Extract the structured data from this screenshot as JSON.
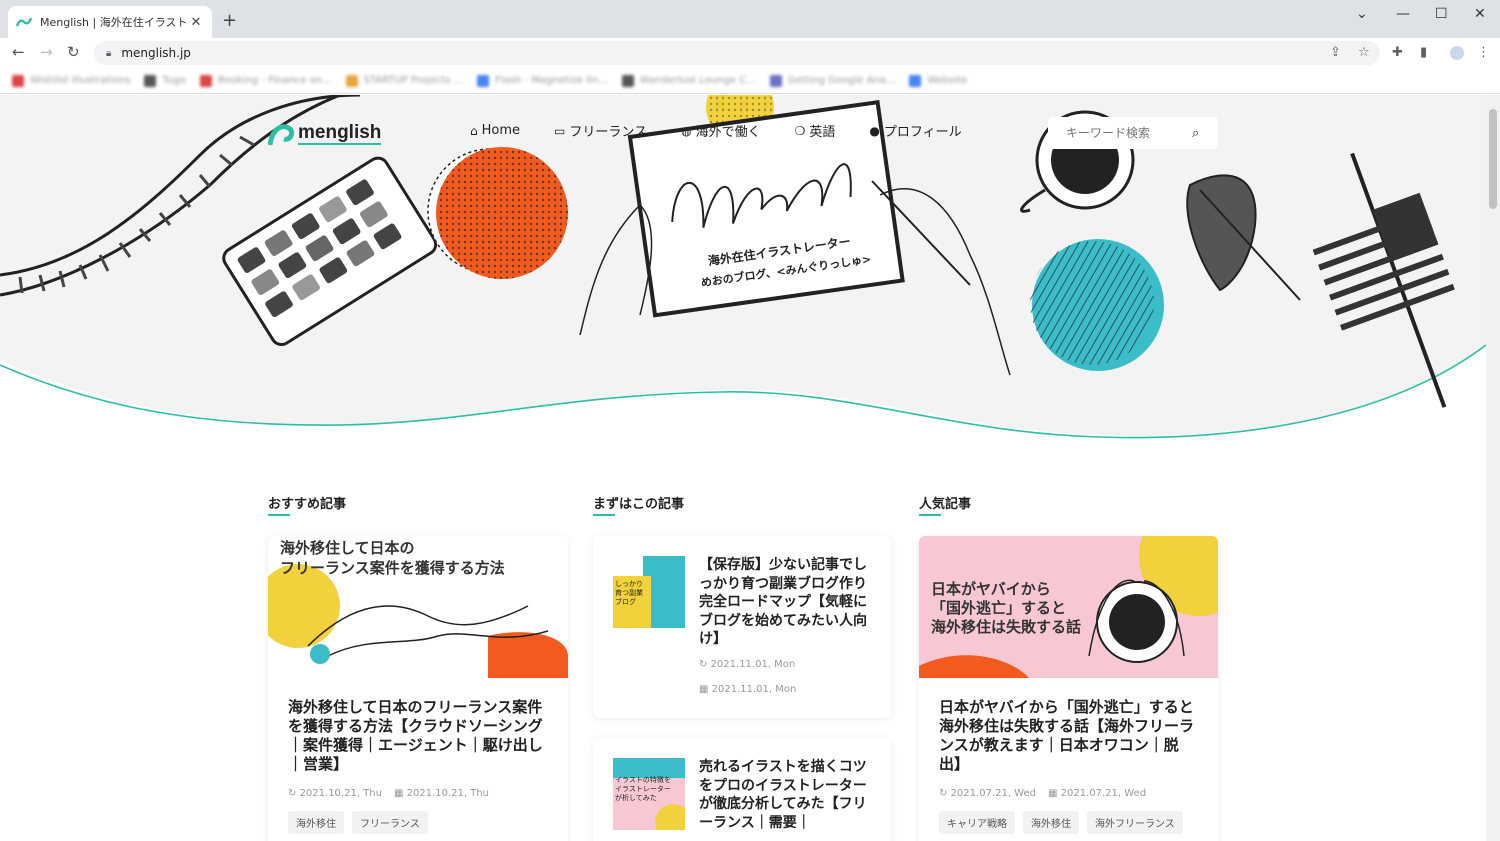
{
  "browser": {
    "tab_title": "Menglish | 海外在住イラストレータ...",
    "url": "menglish.jp",
    "bookmarks": [
      {
        "label": "Wishlist Illustrations",
        "color": "#d44"
      },
      {
        "label": "Tugo",
        "color": "#555"
      },
      {
        "label": "Booking - Finance on...",
        "color": "#d44"
      },
      {
        "label": "STARTUP Projects ...",
        "color": "#e8a33c"
      },
      {
        "label": "Flash - Magnetize lin...",
        "color": "#4285f4"
      },
      {
        "label": "Wanderlust Lounge C...",
        "color": "#555"
      },
      {
        "label": "Getting Google Ana...",
        "color": "#6b6fc4"
      },
      {
        "label": "Website",
        "color": "#4285f4"
      }
    ]
  },
  "site": {
    "logo_text": "menglish",
    "nav": [
      {
        "icon": "home-icon",
        "glyph": "⌂",
        "label": "Home"
      },
      {
        "icon": "laptop-icon",
        "glyph": "▭",
        "label": "フリーランス"
      },
      {
        "icon": "globe-icon",
        "glyph": "◍",
        "label": "海外で働く"
      },
      {
        "icon": "chat-icon",
        "glyph": "❍",
        "label": "英語"
      },
      {
        "icon": "user-icon",
        "glyph": "●",
        "label": "プロフィール"
      }
    ],
    "search_placeholder": "キーワード検索",
    "hero_text": {
      "line1": "海外在住イラストレーター",
      "line2": "めおのブログ、<みんぐりっしゅ>"
    }
  },
  "sections": {
    "recommended": {
      "title": "おすすめ記事",
      "thumb_text": [
        "海外移住して日本の",
        "フリーランス案件を獲得する方法"
      ],
      "article_title": "海外移住して日本のフリーランス案件を獲得する方法【クラウドソーシング｜案件獲得｜エージェント｜駆け出し｜営業】",
      "updated": "2021.10.21, Thu",
      "published": "2021.10.21, Thu",
      "tags": [
        "海外移住",
        "フリーランス"
      ]
    },
    "first": {
      "title": "まずはこの記事",
      "articles": [
        {
          "thumb_text": "しっかり育つ副業ブログ",
          "article_title": "【保存版】少ない記事でしっかり育つ副業ブログ作り完全ロードマップ【気軽にブログを始めてみたい人向け】",
          "updated": "2021.11.01, Mon",
          "published": "2021.11.01, Mon"
        },
        {
          "thumb_text": "イラストの特徴をイラストレーターが析してみた",
          "article_title": "売れるイラストを描くコツをプロのイラストレーターが徹底分析してみた【フリーランス｜需要｜"
        }
      ]
    },
    "popular": {
      "title": "人気記事",
      "thumb_text": [
        "日本がヤバイから",
        "「国外逃亡」すると",
        "海外移住は失敗する話"
      ],
      "article_title": "日本がヤバイから「国外逃亡」すると海外移住は失敗する話【海外フリーランスが教えます｜日本オワコン｜脱出】",
      "updated": "2021.07.21, Wed",
      "published": "2021.07.21, Wed",
      "tags": [
        "キャリア戦略",
        "海外移住",
        "海外フリーランス"
      ]
    }
  },
  "colors": {
    "accent": "#2bbfa4",
    "orange": "#f25a1e",
    "yellow": "#f2d23c",
    "cyan": "#3bbcc9",
    "pink": "#f7c8d4"
  }
}
